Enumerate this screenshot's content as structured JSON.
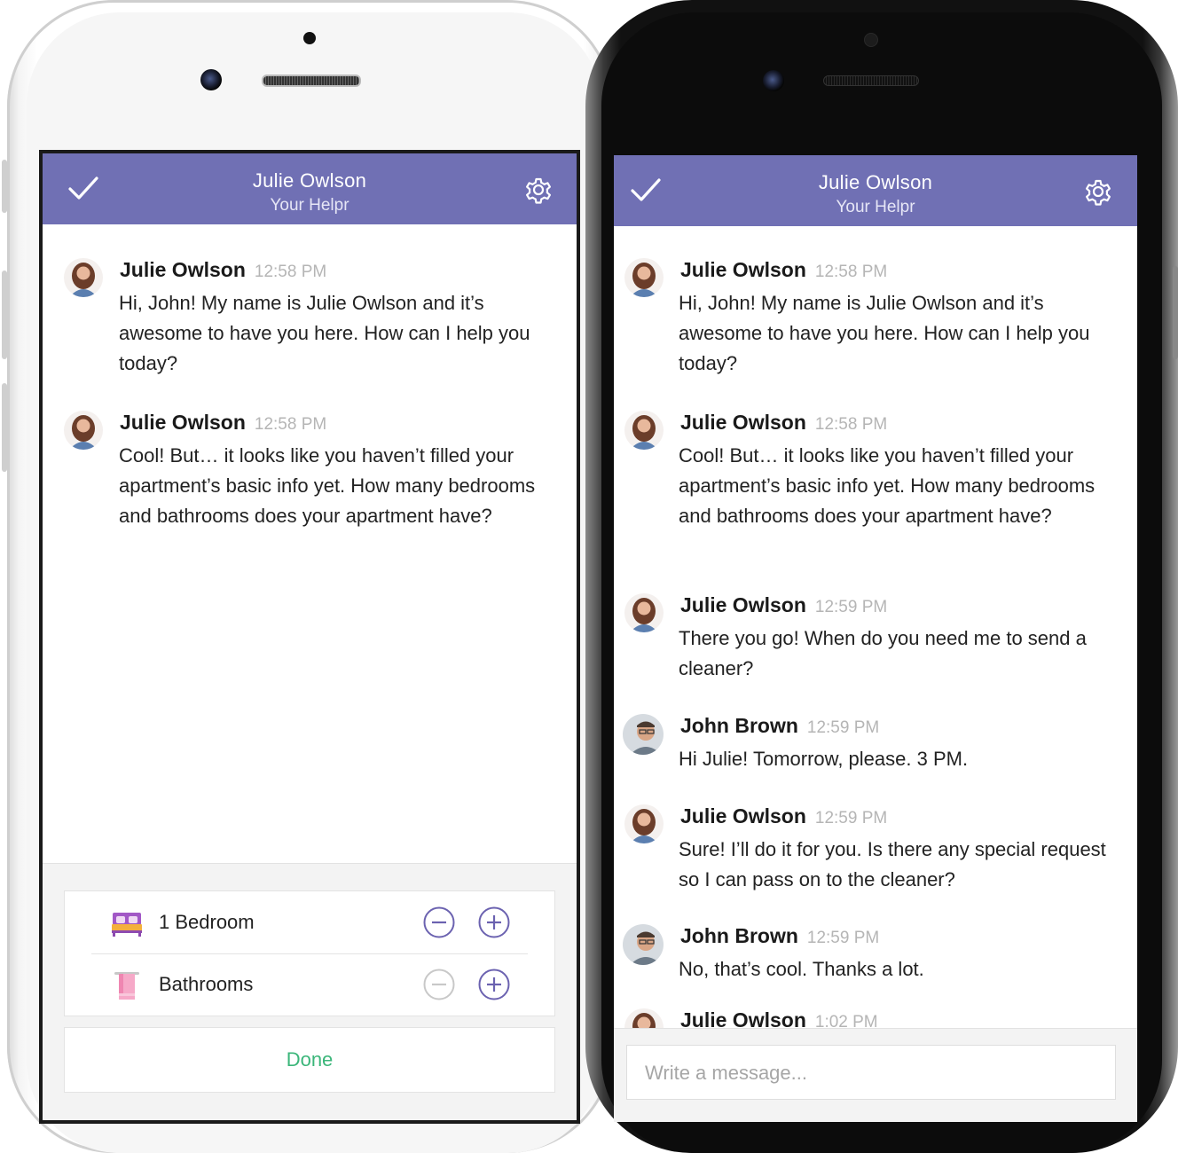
{
  "colors": {
    "header": "#7070b4",
    "done": "#3bb67a",
    "stepper": "#6b62b0",
    "stepper_disabled": "#c8c8c8"
  },
  "left_phone": {
    "header": {
      "title": "Julie Owlson",
      "subtitle": "Your Helpr",
      "left_icon": "check-icon",
      "right_icon": "gear-icon"
    },
    "messages": [
      {
        "sender": "Julie Owlson",
        "time": "12:58 PM",
        "text": "Hi, John! My name is Julie Owlson and it’s awesome to have you here. How can I help you today?"
      },
      {
        "sender": "Julie Owlson",
        "time": "12:58 PM",
        "text": "Cool! But… it looks like you haven’t filled your apartment’s basic info yet. How many bedrooms and bathrooms does your apartment have?"
      }
    ],
    "counters": [
      {
        "label": "1 Bedroom",
        "icon": "bed-icon",
        "minus_enabled": true
      },
      {
        "label": "Bathrooms",
        "icon": "towel-icon",
        "minus_enabled": false
      }
    ],
    "done_label": "Done"
  },
  "right_phone": {
    "header": {
      "title": "Julie Owlson",
      "subtitle": "Your Helpr",
      "left_icon": "check-icon",
      "right_icon": "gear-icon"
    },
    "messages": [
      {
        "sender": "Julie Owlson",
        "time": "12:58 PM",
        "text": "Hi, John! My name is Julie Owlson and it’s awesome to have you here. How can I help you today?"
      },
      {
        "sender": "Julie Owlson",
        "time": "12:58 PM",
        "text": "Cool! But… it looks like you haven’t filled your apartment’s basic info yet. How many bedrooms and bathrooms does your apartment have?"
      },
      {
        "sender": "Julie Owlson",
        "time": "12:59 PM",
        "text": "There you go! When do you need me to send a cleaner?"
      },
      {
        "sender": "John Brown",
        "time": "12:59 PM",
        "text": "Hi Julie! Tomorrow, please. 3 PM."
      },
      {
        "sender": "Julie Owlson",
        "time": "12:59 PM",
        "text": "Sure! I’ll do it for you. Is there any special request so I can pass on to the cleaner?"
      },
      {
        "sender": "John Brown",
        "time": "12:59 PM",
        "text": "No, that’s cool. Thanks a lot."
      },
      {
        "sender": "Julie Owlson",
        "time": "1:02 PM",
        "text": ""
      }
    ],
    "compose_placeholder": "Write a message..."
  }
}
